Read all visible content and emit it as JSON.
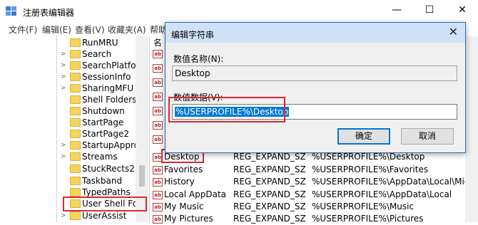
{
  "window": {
    "title": "注册表编辑器",
    "minimize": "—",
    "maximize": "☐",
    "close": "✕"
  },
  "menu": [
    "文件(F)",
    "编辑(E)",
    "查看(V)",
    "收藏夹(A)",
    "帮助"
  ],
  "tree": {
    "items": [
      {
        "label": "RunMRU",
        "expander": ""
      },
      {
        "label": "Search",
        "expander": ">"
      },
      {
        "label": "SearchPlatforr",
        "expander": ">"
      },
      {
        "label": "SessionInfo",
        "expander": ">"
      },
      {
        "label": "SharingMFU",
        "expander": ">"
      },
      {
        "label": "Shell Folders",
        "expander": ""
      },
      {
        "label": "Shutdown",
        "expander": ""
      },
      {
        "label": "StartPage",
        "expander": ""
      },
      {
        "label": "StartPage2",
        "expander": ""
      },
      {
        "label": "StartupAppro",
        "expander": ">"
      },
      {
        "label": "Streams",
        "expander": ">"
      },
      {
        "label": "StuckRects2",
        "expander": ""
      },
      {
        "label": "Taskband",
        "expander": ""
      },
      {
        "label": "TypedPaths",
        "expander": ""
      },
      {
        "label": "User Shell Fold",
        "expander": ""
      },
      {
        "label": "UserAssist",
        "expander": ">"
      }
    ]
  },
  "list": {
    "column_name_header": "名",
    "rows": [
      {
        "name": "Desktop",
        "type": "REG_EXPAND_SZ",
        "data": "%USERPROFILE%\\Desktop"
      },
      {
        "name": "Favorites",
        "type": "REG_EXPAND_SZ",
        "data": "%USERPROFILE%\\Favorites"
      },
      {
        "name": "History",
        "type": "REG_EXPAND_SZ",
        "data": "%USERPROFILE%\\AppData\\Local\\Micros"
      },
      {
        "name": "Local AppData",
        "type": "REG_EXPAND_SZ",
        "data": "%USERPROFILE%\\AppData\\Local"
      },
      {
        "name": "My Music",
        "type": "REG_EXPAND_SZ",
        "data": "%USERPROFILE%\\Music"
      },
      {
        "name": "My Pictures",
        "type": "REG_EXPAND_SZ",
        "data": "%USERPROFILE%\\Pictures"
      }
    ]
  },
  "dialog": {
    "title": "编辑字符串",
    "close": "✕",
    "name_label": "数值名称(N):",
    "name_value": "Desktop",
    "data_label": "数值数据(V):",
    "data_value": "%USERPROFILE%\\Desktop",
    "ok_label": "确定",
    "cancel_label": "取消"
  },
  "colors": {
    "highlight_box": "#e0262d",
    "selection": "#0078d7",
    "dialog_title_bg": "#cfe2f7",
    "folder": "#f5d45e"
  },
  "icons": {
    "app": "regedit-icon",
    "folder": "folder-icon",
    "reg_value": "reg-string-icon"
  }
}
